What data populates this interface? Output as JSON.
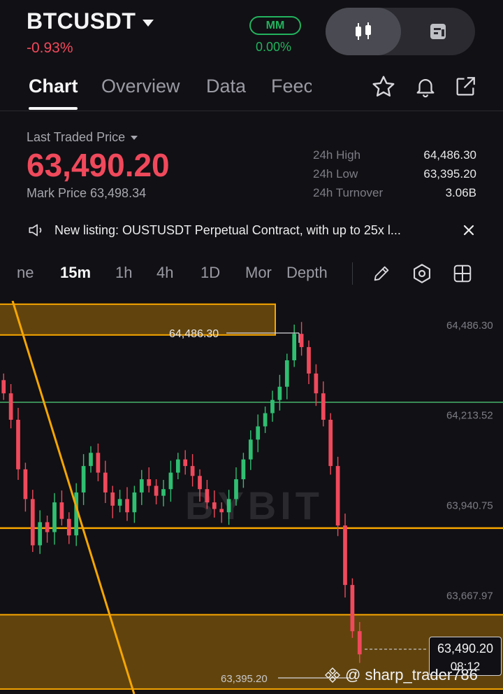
{
  "header": {
    "symbol": "BTCUSDT",
    "change": "-0.93%",
    "mm_label": "MM",
    "mm_value": "0.00%"
  },
  "tabs": [
    "Chart",
    "Overview",
    "Data",
    "Feec"
  ],
  "price": {
    "ltp_label": "Last Traded Price",
    "ltp": "63,490.20",
    "mark": "Mark Price 63,498.34",
    "stats": [
      {
        "label": "24h High",
        "value": "64,486.30"
      },
      {
        "label": "24h Low",
        "value": "63,395.20"
      },
      {
        "label": "24h Turnover",
        "value": "3.06B"
      }
    ]
  },
  "notice": {
    "text": "New listing: OUSTUSDT Perpetual Contract, with up to 25x l..."
  },
  "timeframes": [
    "ne",
    "15m",
    "1h",
    "4h",
    "1D",
    "Mor",
    "Depth"
  ],
  "chart": {
    "high_label": "64,486.30",
    "low_label": "63,395.20",
    "watermark_brand": "BYBIT",
    "current_price": "63,490.20",
    "countdown": "08:12",
    "credit": "@ sharp_trader786",
    "colors": {
      "up": "#2fbf71",
      "down": "#f0495c",
      "zone": "#f7a600",
      "support": "#45b26b"
    }
  },
  "chart_data": {
    "type": "candlestick",
    "y_ticks": [
      "64,486.30",
      "64,213.52",
      "63,940.75",
      "63,667.97"
    ],
    "ylim": [
      63370,
      64560
    ],
    "high": 64486.3,
    "low": 63395.2,
    "last": 63490.2,
    "close_series": [
      64280,
      64200,
      64050,
      63960,
      63820,
      63890,
      63860,
      63950,
      63900,
      63850,
      63980,
      64060,
      64100,
      64040,
      63980,
      63940,
      63960,
      63920,
      63980,
      64020,
      64000,
      63970,
      63990,
      64040,
      64080,
      64060,
      64030,
      63990,
      63950,
      63930,
      63920,
      63960,
      64020,
      64080,
      64140,
      64180,
      64220,
      64260,
      64300,
      64380,
      64460,
      64420,
      64340,
      64280,
      64200,
      64060,
      63880,
      63700,
      63560,
      63490
    ],
    "horizontal_lines": [
      64253,
      63872
    ],
    "zones": [
      [
        64486.3,
        64420
      ],
      [
        63610,
        63385
      ]
    ]
  }
}
